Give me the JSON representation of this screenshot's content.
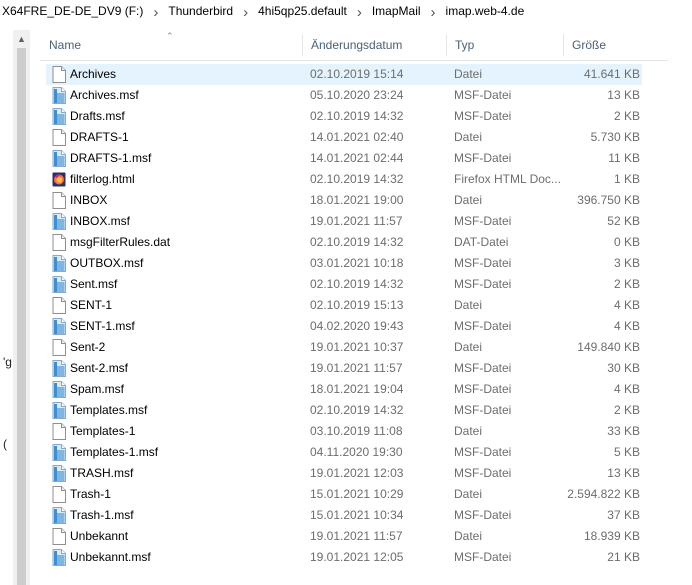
{
  "breadcrumb": [
    "X64FRE_DE-DE_DV9 (F:)",
    "Thunderbird",
    "4hi5qp25.default",
    "ImapMail",
    "imap.web-4.de"
  ],
  "left_pane_fragments": [
    "'g",
    "("
  ],
  "columns": {
    "name": "Name",
    "date": "Änderungsdatum",
    "type": "Typ",
    "size": "Größe"
  },
  "files": [
    {
      "name": "Archives",
      "date": "02.10.2019 15:14",
      "type": "Datei",
      "size": "41.641 KB",
      "icon": "blank-file-icon",
      "selected": true
    },
    {
      "name": "Archives.msf",
      "date": "05.10.2020 23:24",
      "type": "MSF-Datei",
      "size": "13 KB",
      "icon": "msf-file-icon"
    },
    {
      "name": "Drafts.msf",
      "date": "02.10.2019 14:32",
      "type": "MSF-Datei",
      "size": "2 KB",
      "icon": "msf-file-icon"
    },
    {
      "name": "DRAFTS-1",
      "date": "14.01.2021 02:40",
      "type": "Datei",
      "size": "5.730 KB",
      "icon": "blank-file-icon"
    },
    {
      "name": "DRAFTS-1.msf",
      "date": "14.01.2021 02:44",
      "type": "MSF-Datei",
      "size": "11 KB",
      "icon": "msf-file-icon"
    },
    {
      "name": "filterlog.html",
      "date": "02.10.2019 14:32",
      "type": "Firefox HTML Doc...",
      "size": "1 KB",
      "icon": "firefox-html-icon"
    },
    {
      "name": "INBOX",
      "date": "18.01.2021 19:00",
      "type": "Datei",
      "size": "396.750 KB",
      "icon": "blank-file-icon"
    },
    {
      "name": "INBOX.msf",
      "date": "19.01.2021 11:57",
      "type": "MSF-Datei",
      "size": "52 KB",
      "icon": "msf-file-icon"
    },
    {
      "name": "msgFilterRules.dat",
      "date": "02.10.2019 14:32",
      "type": "DAT-Datei",
      "size": "0 KB",
      "icon": "blank-file-icon"
    },
    {
      "name": "OUTBOX.msf",
      "date": "03.01.2021 10:18",
      "type": "MSF-Datei",
      "size": "3 KB",
      "icon": "msf-file-icon"
    },
    {
      "name": "Sent.msf",
      "date": "02.10.2019 14:32",
      "type": "MSF-Datei",
      "size": "2 KB",
      "icon": "msf-file-icon"
    },
    {
      "name": "SENT-1",
      "date": "02.10.2019 15:13",
      "type": "Datei",
      "size": "4 KB",
      "icon": "blank-file-icon"
    },
    {
      "name": "SENT-1.msf",
      "date": "04.02.2020 19:43",
      "type": "MSF-Datei",
      "size": "4 KB",
      "icon": "msf-file-icon"
    },
    {
      "name": "Sent-2",
      "date": "19.01.2021 10:37",
      "type": "Datei",
      "size": "149.840 KB",
      "icon": "blank-file-icon"
    },
    {
      "name": "Sent-2.msf",
      "date": "19.01.2021 11:57",
      "type": "MSF-Datei",
      "size": "30 KB",
      "icon": "msf-file-icon"
    },
    {
      "name": "Spam.msf",
      "date": "18.01.2021 19:04",
      "type": "MSF-Datei",
      "size": "4 KB",
      "icon": "msf-file-icon"
    },
    {
      "name": "Templates.msf",
      "date": "02.10.2019 14:32",
      "type": "MSF-Datei",
      "size": "2 KB",
      "icon": "msf-file-icon"
    },
    {
      "name": "Templates-1",
      "date": "03.10.2019 11:08",
      "type": "Datei",
      "size": "33 KB",
      "icon": "blank-file-icon"
    },
    {
      "name": "Templates-1.msf",
      "date": "04.11.2020 19:30",
      "type": "MSF-Datei",
      "size": "5 KB",
      "icon": "msf-file-icon"
    },
    {
      "name": "TRASH.msf",
      "date": "19.01.2021 12:03",
      "type": "MSF-Datei",
      "size": "13 KB",
      "icon": "msf-file-icon"
    },
    {
      "name": "Trash-1",
      "date": "15.01.2021 10:29",
      "type": "Datei",
      "size": "2.594.822 KB",
      "icon": "blank-file-icon"
    },
    {
      "name": "Trash-1.msf",
      "date": "15.01.2021 10:34",
      "type": "MSF-Datei",
      "size": "37 KB",
      "icon": "msf-file-icon"
    },
    {
      "name": "Unbekannt",
      "date": "19.01.2021 11:57",
      "type": "Datei",
      "size": "18.939 KB",
      "icon": "blank-file-icon"
    },
    {
      "name": "Unbekannt.msf",
      "date": "19.01.2021 12:05",
      "type": "MSF-Datei",
      "size": "21 KB",
      "icon": "msf-file-icon"
    }
  ],
  "colors": {
    "selection": "#e5f3ff",
    "header_text": "#4c607a",
    "secondary_text": "#6d6d6d",
    "msf_icon": "#3d8fd1"
  }
}
